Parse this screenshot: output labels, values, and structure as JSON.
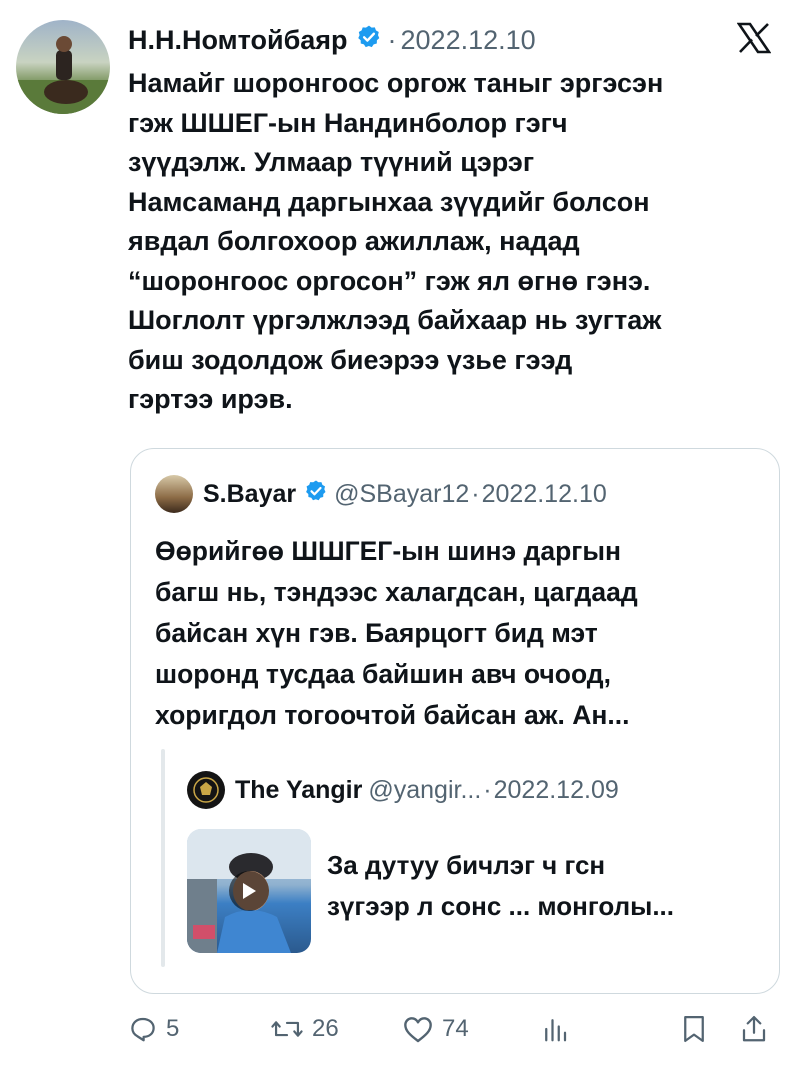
{
  "tweet": {
    "author_name": "Н.Н.Номтойбаяр",
    "separator": "·",
    "date": "2022.12.10",
    "text_lines": [
      "Намайг шоронгоос оргож таныг эргэсэн",
      "гэж ШШЕГ-ын Нандинболор гэгч",
      "зүүдэлж. Улмаар түүний цэрэг",
      "Намсаманд даргынхаа зүүдийг болсон",
      "явдал болгохоор ажиллаж, надад",
      "“шоронгоос оргосон” гэж ял өгнө гэнэ.",
      "Шоглолт үргэлжлээд байхаар нь зугтаж",
      "биш зодолдож биеэрээ үзье гээд",
      "гэртээ ирэв."
    ]
  },
  "quoted": {
    "author_name": "S.Bayar",
    "handle": "@SBayar12",
    "separator": "·",
    "date": "2022.12.10",
    "text_lines": [
      "Өөрийгөө ШШГЕГ-ын шинэ даргын",
      "багш нь, тэндээс халагдсан, цагдаад",
      "байсан хүн гэв. Баярцогт бид мэт",
      "шоронд тусдаа байшин авч очоод,",
      "хоригдол тогоочтой байсан аж. Ан..."
    ]
  },
  "nested": {
    "author_name": "The Yangir",
    "handle": "@yangir...",
    "separator": "·",
    "date": "2022.12.09",
    "text_lines": [
      "За дутуу бичлэг ч гсн",
      "зүгээр л сонс ... монголы..."
    ]
  },
  "actions": {
    "replies": "5",
    "retweets": "26",
    "likes": "74"
  },
  "icons": [
    "x-logo-icon",
    "verified-badge-icon",
    "reply-icon",
    "retweet-icon",
    "like-icon",
    "views-icon",
    "bookmark-icon",
    "share-icon",
    "play-icon"
  ],
  "colors": {
    "text": "#0f1419",
    "secondary": "#536471",
    "verified": "#1d9bf0",
    "border": "#cfd9de"
  }
}
